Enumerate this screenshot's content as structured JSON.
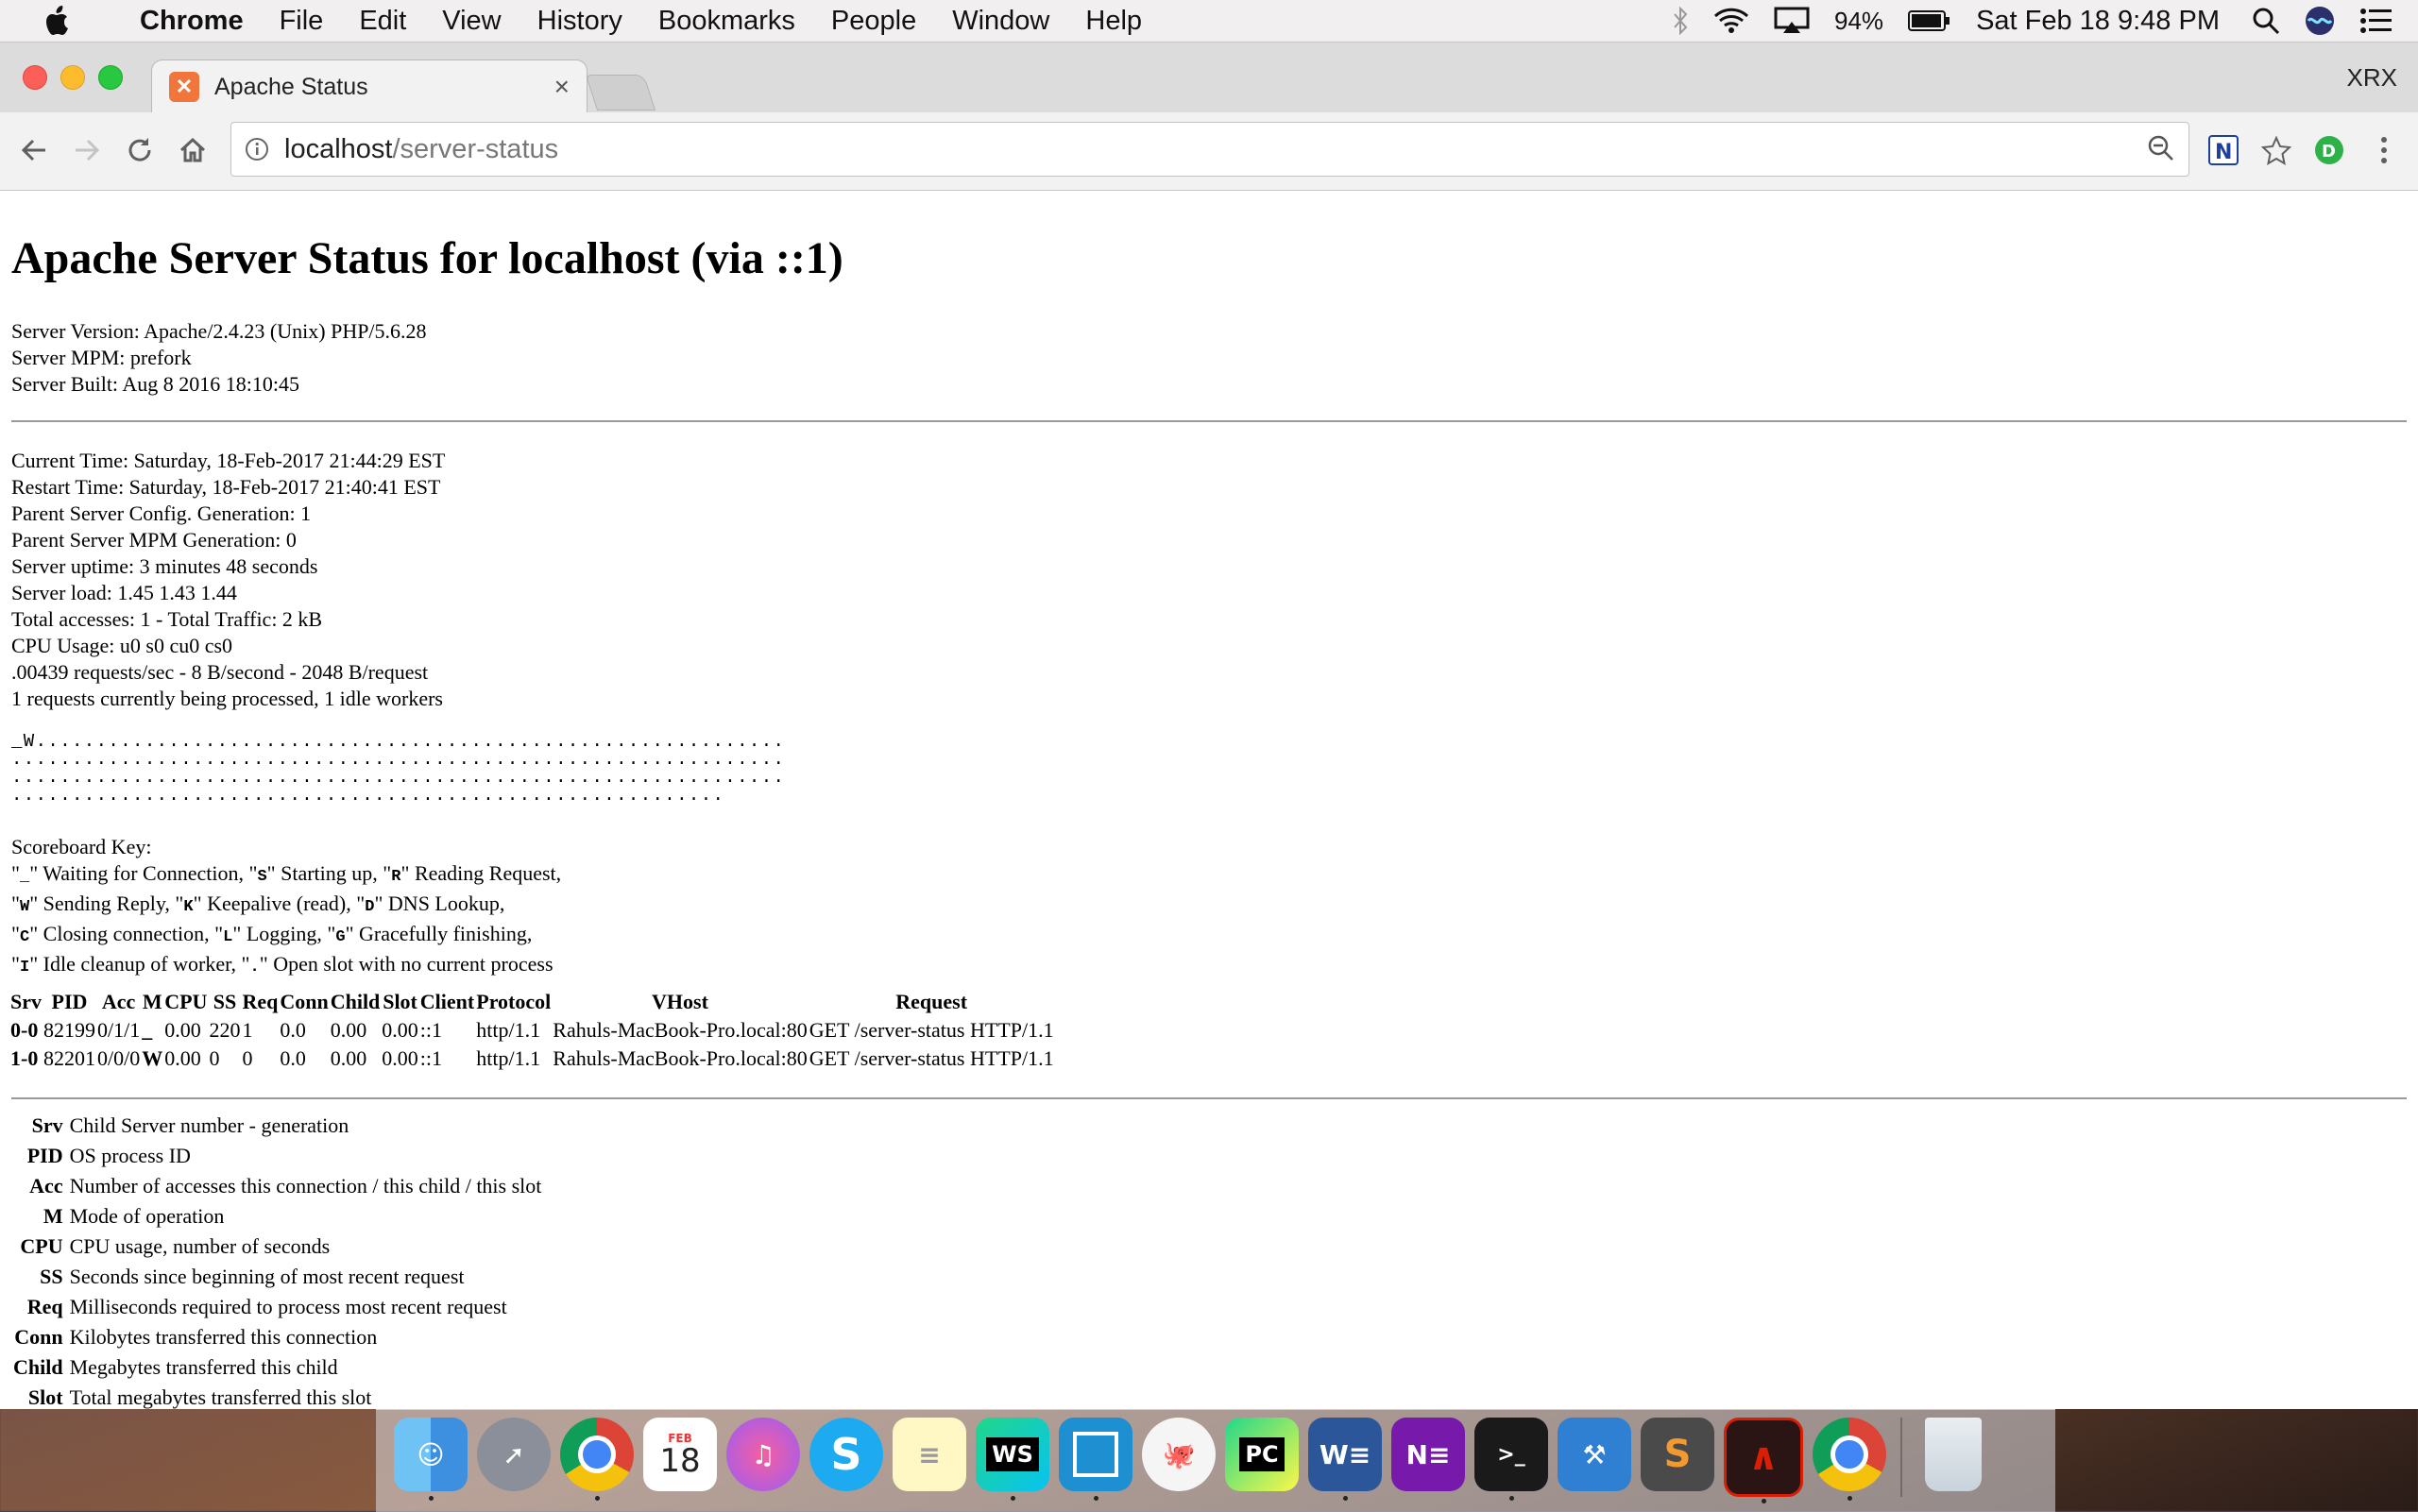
{
  "menubar": {
    "app_name": "Chrome",
    "items": [
      "File",
      "Edit",
      "View",
      "History",
      "Bookmarks",
      "People",
      "Window",
      "Help"
    ],
    "battery": "94%",
    "datetime": "Sat Feb 18  9:48 PM"
  },
  "browser": {
    "tab_title": "Apache Status",
    "profile_label": "XRX",
    "url_host": "localhost",
    "url_path": "/server-status"
  },
  "page": {
    "heading": "Apache Server Status for localhost (via ::1)",
    "server_info": [
      "Server Version: Apache/2.4.23 (Unix) PHP/5.6.28",
      "Server MPM: prefork",
      "Server Built: Aug 8 2016 18:10:45"
    ],
    "status_info": [
      "Current Time: Saturday, 18-Feb-2017 21:44:29 EST",
      "Restart Time: Saturday, 18-Feb-2017 21:40:41 EST",
      "Parent Server Config. Generation: 1",
      "Parent Server MPM Generation: 0",
      "Server uptime: 3 minutes 48 seconds",
      "Server load: 1.45 1.43 1.44",
      "Total accesses: 1 - Total Traffic: 2 kB",
      "CPU Usage: u0 s0 cu0 cs0",
      ".00439 requests/sec - 8 B/second - 2048 B/request",
      "1 requests currently being processed, 1 idle workers"
    ],
    "scoreboard": [
      "_W..............................................................",
      "................................................................",
      "................................................................",
      "..........................................................."
    ],
    "scoreboard_key_title": "Scoreboard Key:",
    "scoreboard_key": [
      {
        "p1": "\"",
        "c1": "_",
        "t1": "\" Waiting for Connection, \"",
        "c2": "S",
        "t2": "\" Starting up, \"",
        "c3": "R",
        "t3": "\" Reading Request,"
      },
      {
        "p1": "\"",
        "c1": "W",
        "t1": "\" Sending Reply, \"",
        "c2": "K",
        "t2": "\" Keepalive (read), \"",
        "c3": "D",
        "t3": "\" DNS Lookup,"
      },
      {
        "p1": "\"",
        "c1": "C",
        "t1": "\" Closing connection, \"",
        "c2": "L",
        "t2": "\" Logging, \"",
        "c3": "G",
        "t3": "\" Gracefully finishing,"
      },
      {
        "p1": "\"",
        "c1": "I",
        "t1": "\" Idle cleanup of worker, \"",
        "c2": ".",
        "t2": "\" Open slot with no current process",
        "c3": "",
        "t3": ""
      }
    ],
    "process_table": {
      "headers": [
        "Srv",
        "PID",
        "Acc",
        "M",
        "CPU",
        "SS",
        "Req",
        "Conn",
        "Child",
        "Slot",
        "Client",
        "Protocol",
        "VHost",
        "Request"
      ],
      "rows": [
        [
          "0-0",
          "82199",
          "0/1/1",
          "_",
          "0.00",
          "220",
          "1",
          "0.0",
          "0.00",
          "0.00",
          "::1",
          "http/1.1",
          "Rahuls-MacBook-Pro.local:80",
          "GET /server-status HTTP/1.1"
        ],
        [
          "1-0",
          "82201",
          "0/0/0",
          "W",
          "0.00",
          "0",
          "0",
          "0.0",
          "0.00",
          "0.00",
          "::1",
          "http/1.1",
          "Rahuls-MacBook-Pro.local:80",
          "GET /server-status HTTP/1.1"
        ]
      ]
    },
    "legend": [
      {
        "term": "Srv",
        "desc": "Child Server number - generation"
      },
      {
        "term": "PID",
        "desc": "OS process ID"
      },
      {
        "term": "Acc",
        "desc": "Number of accesses this connection / this child / this slot"
      },
      {
        "term": "M",
        "desc": "Mode of operation"
      },
      {
        "term": "CPU",
        "desc": "CPU usage, number of seconds"
      },
      {
        "term": "SS",
        "desc": "Seconds since beginning of most recent request"
      },
      {
        "term": "Req",
        "desc": "Milliseconds required to process most recent request"
      },
      {
        "term": "Conn",
        "desc": "Kilobytes transferred this connection"
      },
      {
        "term": "Child",
        "desc": "Megabytes transferred this child"
      },
      {
        "term": "Slot",
        "desc": "Total megabytes transferred this slot"
      }
    ]
  },
  "dock": {
    "calendar_month": "FEB",
    "calendar_day": "18",
    "apps": [
      "finder-icon",
      "launchpad-icon",
      "chrome-icon",
      "calendar-icon",
      "itunes-icon",
      "skype-icon",
      "notes-icon",
      "webstorm-icon",
      "ide-icon",
      "github-icon",
      "pycharm-icon",
      "word-icon",
      "onenote-icon",
      "terminal-icon",
      "xcode-icon",
      "sublime-icon",
      "acrobat-icon",
      "chrome-icon",
      "trash-icon"
    ]
  }
}
